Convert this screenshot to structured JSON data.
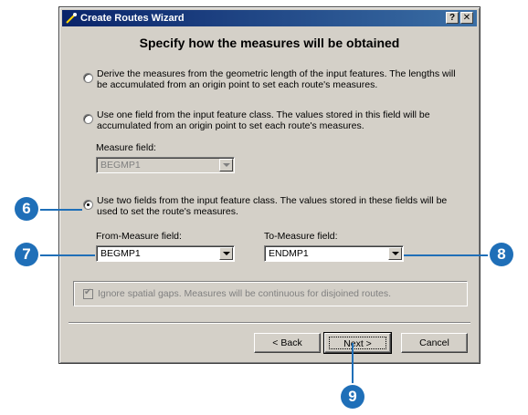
{
  "window": {
    "title": "Create Routes Wizard",
    "help_label": "?",
    "close_label": "✕"
  },
  "heading": "Specify how the measures will be obtained",
  "options": [
    {
      "text": "Derive the measures from the geometric length of the input features.  The lengths will be accumulated from an origin point to set each route's measures.",
      "selected": false
    },
    {
      "text": "Use one field from the input feature class.  The values stored in this field will be accumulated from an origin point to set each route's measures.",
      "selected": false
    },
    {
      "text": "Use two fields from the input feature class.  The values stored in these fields will be used to set the route's measures.",
      "selected": true
    }
  ],
  "measure_field": {
    "label": "Measure field:",
    "value": "BEGMP1"
  },
  "from_measure": {
    "label": "From-Measure field:",
    "value": "BEGMP1"
  },
  "to_measure": {
    "label": "To-Measure field:",
    "value": "ENDMP1"
  },
  "ignore_gaps": {
    "label": "Ignore spatial gaps.  Measures will be continuous for disjoined routes.",
    "checked": true
  },
  "buttons": {
    "back": "< Back",
    "next": "Next >",
    "cancel": "Cancel"
  },
  "callouts": {
    "c6": "6",
    "c7": "7",
    "c8": "8",
    "c9": "9"
  },
  "colors": {
    "callout": "#1f6fb8",
    "titlebar": "#0a246a",
    "dialog": "#d4d0c8"
  }
}
